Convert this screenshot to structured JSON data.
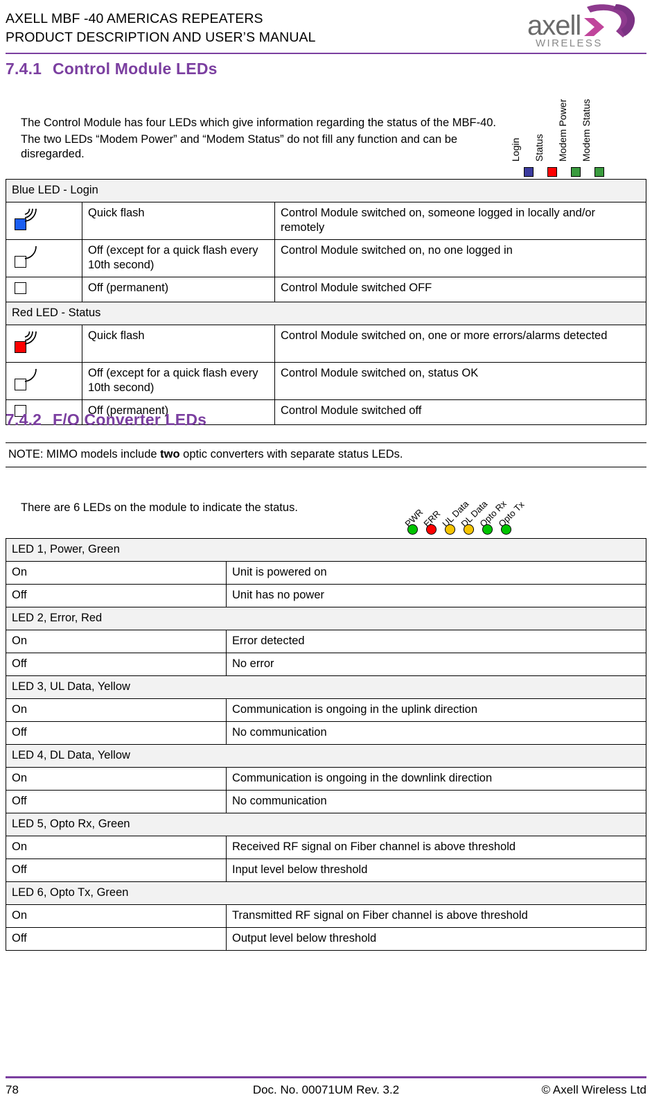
{
  "header": {
    "line1": "AXELL MBF -40 AMERICAS REPEATERS",
    "line2": "PRODUCT DESCRIPTION AND USER’S MANUAL",
    "logo_word": "axell",
    "logo_sub": "WIRELESS",
    "rule_color": "#7b3fa0"
  },
  "section_741": {
    "number": "7.4.1",
    "title": "Control Module LEDs",
    "intro_p1": "The Control Module has four LEDs which give information regarding the status of the MBF-40.",
    "intro_p2": "The two LEDs “Modem Power” and “Modem Status” do not fill any function and can be disregarded.",
    "legend": [
      {
        "label": "Login",
        "color": "#3b3b9e"
      },
      {
        "label": "Status",
        "color": "#fe0000"
      },
      {
        "label": "Modem Power",
        "color": "#3a9b3e"
      },
      {
        "label": "Modem Status",
        "color": "#3a9b3e"
      }
    ],
    "table": {
      "blocks": [
        {
          "section_title": "Blue LED - Login",
          "rows": [
            {
              "icon": "led-quick-flash",
              "icon_fill": "#1a5ef2",
              "state": "Quick flash",
              "meaning": "Control Module switched on, someone logged in locally and/or remotely"
            },
            {
              "icon": "led-off-with-flash",
              "icon_fill": "none",
              "state": "Off (except for a quick flash every 10th second)",
              "meaning": "Control Module switched on, no one logged in"
            },
            {
              "icon": "led-off",
              "icon_fill": "none",
              "state": "Off  (permanent)",
              "meaning": "Control Module switched OFF"
            }
          ]
        },
        {
          "section_title": "Red LED - Status",
          "rows": [
            {
              "icon": "led-quick-flash",
              "icon_fill": "#fe0000",
              "state": "Quick flash",
              "meaning": "Control Module switched on, one or more errors/alarms detected"
            },
            {
              "icon": "led-off-with-flash",
              "icon_fill": "none",
              "state": "Off (except for a quick flash every 10th second)",
              "meaning": "Control Module switched on, status OK"
            },
            {
              "icon": "led-off",
              "icon_fill": "none",
              "state": "Off  (permanent)",
              "meaning": "Control Module switched off"
            }
          ]
        }
      ]
    }
  },
  "section_742": {
    "number": "7.4.2",
    "title": "F/O Converter LEDs",
    "note_prefix": "NOTE: MIMO models include ",
    "note_bold": "two",
    "note_suffix": " optic converters with separate status LEDs.",
    "intro": "There are 6 LEDs on the module to indicate the status.",
    "diagram_leds": [
      {
        "label": "PWR",
        "color": "#00c400"
      },
      {
        "label": "ERR",
        "color": "#fe0000"
      },
      {
        "label": "UL Data",
        "color": "#f5c400"
      },
      {
        "label": "DL Data",
        "color": "#f5c400"
      },
      {
        "label": "Opto Rx",
        "color": "#00c400"
      },
      {
        "label": "Opto Tx",
        "color": "#00c400"
      }
    ],
    "table": {
      "blocks": [
        {
          "section_title": "LED 1, Power, Green",
          "rows": [
            {
              "state": "On",
              "meaning": "Unit is powered on"
            },
            {
              "state": "Off",
              "meaning": "Unit has no power"
            }
          ]
        },
        {
          "section_title": "LED 2, Error, Red",
          "rows": [
            {
              "state": "On",
              "meaning": "Error detected"
            },
            {
              "state": "Off",
              "meaning": "No error"
            }
          ]
        },
        {
          "section_title": "LED 3, UL Data, Yellow",
          "rows": [
            {
              "state": "On",
              "meaning": "Communication is ongoing in the uplink direction"
            },
            {
              "state": "Off",
              "meaning": "No communication"
            }
          ]
        },
        {
          "section_title": "LED 4, DL Data, Yellow",
          "rows": [
            {
              "state": "On",
              "meaning": "Communication is ongoing in the downlink direction"
            },
            {
              "state": "Off",
              "meaning": "No communication"
            }
          ]
        },
        {
          "section_title": "LED 5, Opto Rx, Green",
          "rows": [
            {
              "state": "On",
              "meaning": "Received RF signal on Fiber channel is above threshold"
            },
            {
              "state": "Off",
              "meaning": "Input level below threshold"
            }
          ]
        },
        {
          "section_title": "LED 6, Opto Tx, Green",
          "rows": [
            {
              "state": "On",
              "meaning": "Transmitted RF signal on Fiber channel is above threshold"
            },
            {
              "state": "Off",
              "meaning": "Output level below threshold"
            }
          ]
        }
      ]
    }
  },
  "footer": {
    "page_number": "78",
    "doc_ref": "Doc. No. 00071UM Rev. 3.2",
    "copyright": "© Axell Wireless Ltd"
  }
}
